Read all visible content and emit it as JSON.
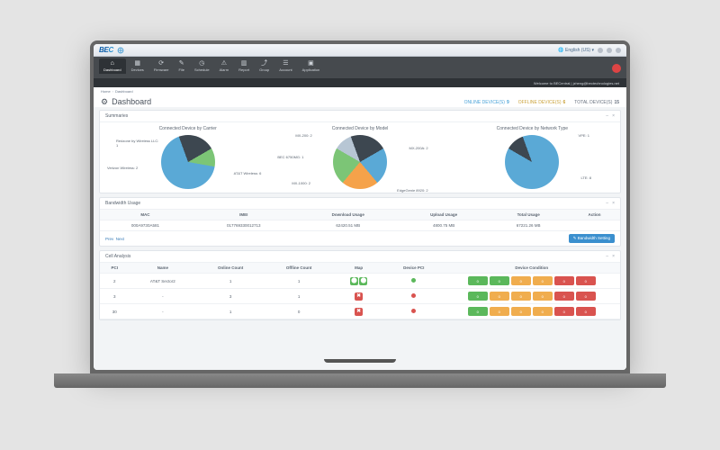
{
  "brand": {
    "text1": "BE",
    "text2": "C"
  },
  "titlebar": {
    "lang": "English (US)"
  },
  "nav": {
    "items": [
      {
        "icon": "⌂",
        "label": "Dashboard"
      },
      {
        "icon": "▦",
        "label": "Devices"
      },
      {
        "icon": "⟳",
        "label": "Firmware"
      },
      {
        "icon": "✎",
        "label": "File"
      },
      {
        "icon": "◷",
        "label": "Schedule"
      },
      {
        "icon": "⚠",
        "label": "Alarm"
      },
      {
        "icon": "▥",
        "label": "Report"
      },
      {
        "icon": "⤴",
        "label": "Group"
      },
      {
        "icon": "☰",
        "label": "Account"
      },
      {
        "icon": "▣",
        "label": "Application"
      }
    ]
  },
  "welcome": "Welcome to BECentral | jzheng@bectechnologies.net",
  "breadcrumb": {
    "a": "Home",
    "b": "Dashboard"
  },
  "page": {
    "title": "Dashboard"
  },
  "counts": {
    "online": {
      "label": "ONLINE DEVICE(S)",
      "value": "9"
    },
    "offline": {
      "label": "OFFLINE DEVICE(S)",
      "value": "6"
    },
    "total": {
      "label": "TOTAL DEVICE(S)",
      "value": "15"
    }
  },
  "summaries": {
    "title": "Summaries"
  },
  "chart_data": [
    {
      "type": "pie",
      "title": "Connected Device by Carrier",
      "series": [
        {
          "name": "Verizon Wireless",
          "value": 2
        },
        {
          "name": "Redzone by Wireless LLC",
          "value": 1
        },
        {
          "name": "AT&T Wireless",
          "value": 6
        }
      ],
      "colors": [
        "#3d4750",
        "#7cc576",
        "#5aa9d6"
      ]
    },
    {
      "type": "pie",
      "title": "Connected Device by Model",
      "series": [
        {
          "name": "MX-200",
          "value": 2
        },
        {
          "name": "MX-200A",
          "value": 2
        },
        {
          "name": "EdgeGenie 8920",
          "value": 2
        },
        {
          "name": "MX-1000",
          "value": 2
        },
        {
          "name": "BEC 6750MG",
          "value": 1
        }
      ],
      "colors": [
        "#3d4750",
        "#5aa9d6",
        "#f5a24a",
        "#7cc576",
        "#b7c6d4"
      ]
    },
    {
      "type": "pie",
      "title": "Connected Device by Network Type",
      "series": [
        {
          "name": "LTE",
          "value": 8
        },
        {
          "name": "VPE",
          "value": 1
        }
      ],
      "colors": [
        "#5aa9d6",
        "#3d4750"
      ]
    }
  ],
  "bandwidth": {
    "title": "Bandwidth Usage",
    "headers": [
      "MAC",
      "IMEI",
      "Download Usage",
      "Upload Usage",
      "Total Usage",
      "Action"
    ],
    "row": {
      "mac": "000A9730A581",
      "imei": "017769330012713",
      "down": "62420.51 MB",
      "up": "4800.75 MB",
      "total": "67221.26 MB"
    },
    "pager": {
      "prev": "Prev",
      "next": "Next"
    },
    "button": "✎ Bandwidth Setting"
  },
  "cell": {
    "title": "Cell Analysis",
    "headers": [
      "PCI",
      "Name",
      "Online Count",
      "Offline Count",
      "Map",
      "Device PCI",
      "Device Condition"
    ],
    "rows": [
      {
        "pci": "2",
        "name": "AT&T Sector2",
        "online": "1",
        "offline": "1",
        "map": "gg",
        "dpci": "g",
        "cond": [
          "g",
          "g",
          "y",
          "y",
          "r",
          "r"
        ]
      },
      {
        "pci": "3",
        "name": "-",
        "online": "3",
        "offline": "1",
        "map": "r",
        "dpci": "r",
        "cond": [
          "g",
          "y",
          "y",
          "y",
          "r",
          "r"
        ]
      },
      {
        "pci": "30",
        "name": "-",
        "online": "1",
        "offline": "0",
        "map": "r",
        "dpci": "r",
        "cond": [
          "g",
          "y",
          "y",
          "y",
          "r",
          "r"
        ]
      }
    ]
  }
}
